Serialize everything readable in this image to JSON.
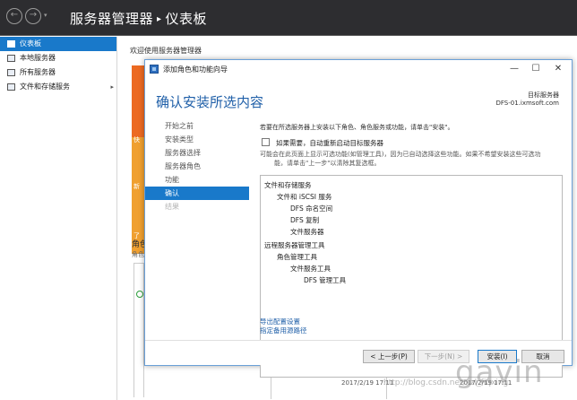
{
  "server_manager": {
    "title_app": "服务器管理器",
    "title_separator": "▸",
    "title_page": "仪表板",
    "nav_back": "←",
    "nav_forward": "→",
    "nav_dropdown": "▾",
    "sidebar_items": [
      {
        "label": "仪表板",
        "active": true
      },
      {
        "label": "本地服务器"
      },
      {
        "label": "所有服务器"
      },
      {
        "label": "文件和存储服务",
        "arrow": "▸"
      }
    ],
    "welcome": "欢迎使用服务器管理器",
    "quick_start_fragments": [
      "快",
      "新",
      "了"
    ],
    "roles_heading": "角色",
    "roles_subtext": "角色",
    "timestamp_1": "2017/2/19 17:11",
    "timestamp_2": "2017/2/19 17:11"
  },
  "wizard": {
    "window_title": "添加角色和功能向导",
    "controls": {
      "minimize": "—",
      "maximize": "☐",
      "close": "✕"
    },
    "heading": "确认安装所选内容",
    "target_label": "目标服务器",
    "target_value": "DFS-01.ixmsoft.com",
    "steps": [
      {
        "label": "开始之前",
        "state": "normal"
      },
      {
        "label": "安装类型",
        "state": "normal"
      },
      {
        "label": "服务器选择",
        "state": "normal"
      },
      {
        "label": "服务器角色",
        "state": "normal"
      },
      {
        "label": "功能",
        "state": "normal"
      },
      {
        "label": "确认",
        "state": "active"
      },
      {
        "label": "结果",
        "state": "disabled"
      }
    ],
    "instruction": "若要在所选服务器上安装以下角色、角色服务或功能，请单击\"安装\"。",
    "restart_checkbox_label": "如果需要，自动重新启动目标服务器",
    "restart_checked": false,
    "note_line1": "可能会在此页面上显示可选功能(如管理工具)，因为已自动选择这些功能。如果不希望安装这些可选功",
    "note_line2": "能，请单击\"上一步\"以清除其复选框。",
    "features": [
      {
        "label": "文件和存储服务",
        "level": 0
      },
      {
        "label": "文件和 iSCSI 服务",
        "level": 1
      },
      {
        "label": "DFS 命名空间",
        "level": 2
      },
      {
        "label": "DFS 复制",
        "level": 2
      },
      {
        "label": "文件服务器",
        "level": 2
      },
      {
        "label": "",
        "level": 0
      },
      {
        "label": "远程服务器管理工具",
        "level": 0
      },
      {
        "label": "角色管理工具",
        "level": 1
      },
      {
        "label": "文件服务工具",
        "level": 2
      },
      {
        "label": "DFS 管理工具",
        "level": 3
      }
    ],
    "link_export": "导出配置设置",
    "link_alt_source": "指定备用源路径",
    "buttons": {
      "previous": "< 上一步(P)",
      "next": "下一步(N) >",
      "install": "安装(I)",
      "cancel": "取消"
    }
  },
  "watermark": {
    "name": "gavin",
    "url": "http://blog.csdn.net/xzl_fiqxing"
  }
}
